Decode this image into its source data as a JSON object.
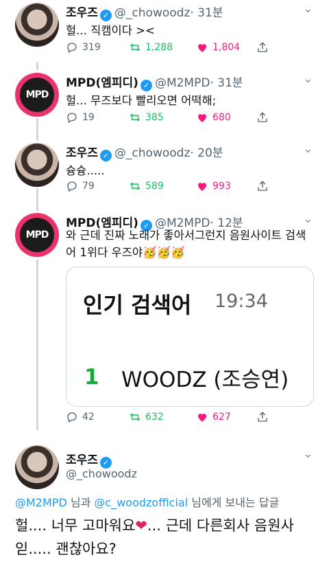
{
  "tweets": [
    {
      "name": "조우즈",
      "handle": "@_chowoodz",
      "time": "· 31분",
      "text": "헐... 직캠이다 ><",
      "replies": "319",
      "retweets": "1,288",
      "likes": "1,804"
    },
    {
      "name": "MPD(엠피디)",
      "handle": "@M2MPD",
      "time": "· 31분",
      "text": "헐... 무즈보다 빨리오면 어떡해;",
      "replies": "19",
      "retweets": "385",
      "likes": "680"
    },
    {
      "name": "조우즈",
      "handle": "@_chowoodz",
      "time": "· 20분",
      "text": "슝슝.....",
      "replies": "79",
      "retweets": "589",
      "likes": "993"
    },
    {
      "name": "MPD(엠피디)",
      "handle": "@M2MPD",
      "time": "· 12분",
      "text": "와 근데 진짜 노래가 좋아서그런지 음원사이트 검색어 1위다 우즈야🥳🥳🥳",
      "replies": "42",
      "retweets": "632",
      "likes": "627",
      "card": {
        "title": "인기 검색어",
        "time": "19:34",
        "rank": "1",
        "term": "WOODZ (조승연)"
      }
    }
  ],
  "main_tweet": {
    "name": "조우즈",
    "handle": "@_chowoodz",
    "replying_mention1": "@M2MPD",
    "replying_mid": " 님과 ",
    "replying_mention2": "@c_woodzofficial",
    "replying_tail": " 님에게 보내는 답글",
    "text_part1": "헐.... 너무 고마워요",
    "heart": "❤",
    "text_part2": "... 근데 다른회사 음원사읻..... 괜찮아요?"
  },
  "avatar_logo": "MPD",
  "colors": {
    "retweet": "#17bf63",
    "like": "#f91880",
    "link": "#1d9bf0",
    "verified": "#1d9bf0"
  }
}
